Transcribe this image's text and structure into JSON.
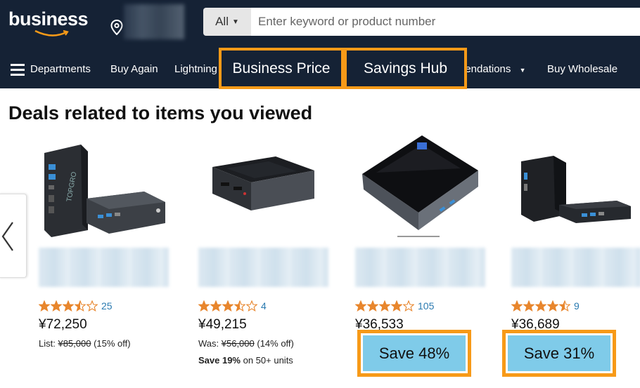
{
  "header": {
    "logo_text": "business",
    "search_category": "All",
    "search_placeholder": "Enter keyword or product number"
  },
  "nav": {
    "departments": "Departments",
    "buy_again": "Buy Again",
    "lightning": "Lightning",
    "business_price": "Business Price",
    "savings_hub": "Savings Hub",
    "recommendations": "nendations",
    "buy_wholesale": "Buy Wholesale"
  },
  "section": {
    "title": "Deals related to items you viewed"
  },
  "products": [
    {
      "rating": 3.5,
      "reviews": "25",
      "price": "¥72,250",
      "list_prefix": "List: ",
      "list_price": "¥85,000",
      "list_suffix": " (15% off)"
    },
    {
      "rating": 3.5,
      "reviews": "4",
      "price": "¥49,215",
      "list_prefix": "Was: ",
      "list_price": "¥56,000",
      "list_suffix": " (14% off)",
      "promo_bold": "Save 19%",
      "promo_rest": " on 50+ units"
    },
    {
      "rating": 4.0,
      "reviews": "105",
      "price": "¥36,533",
      "save_label": "Save 48%"
    },
    {
      "rating": 4.5,
      "reviews": "9",
      "price": "¥36,689",
      "save_label": "Save 31%"
    }
  ],
  "colors": {
    "header_bg": "#152235",
    "highlight": "#f79a18",
    "save_bg": "#7fcbe9",
    "star": "#e8862d",
    "link": "#2a7ab0"
  }
}
